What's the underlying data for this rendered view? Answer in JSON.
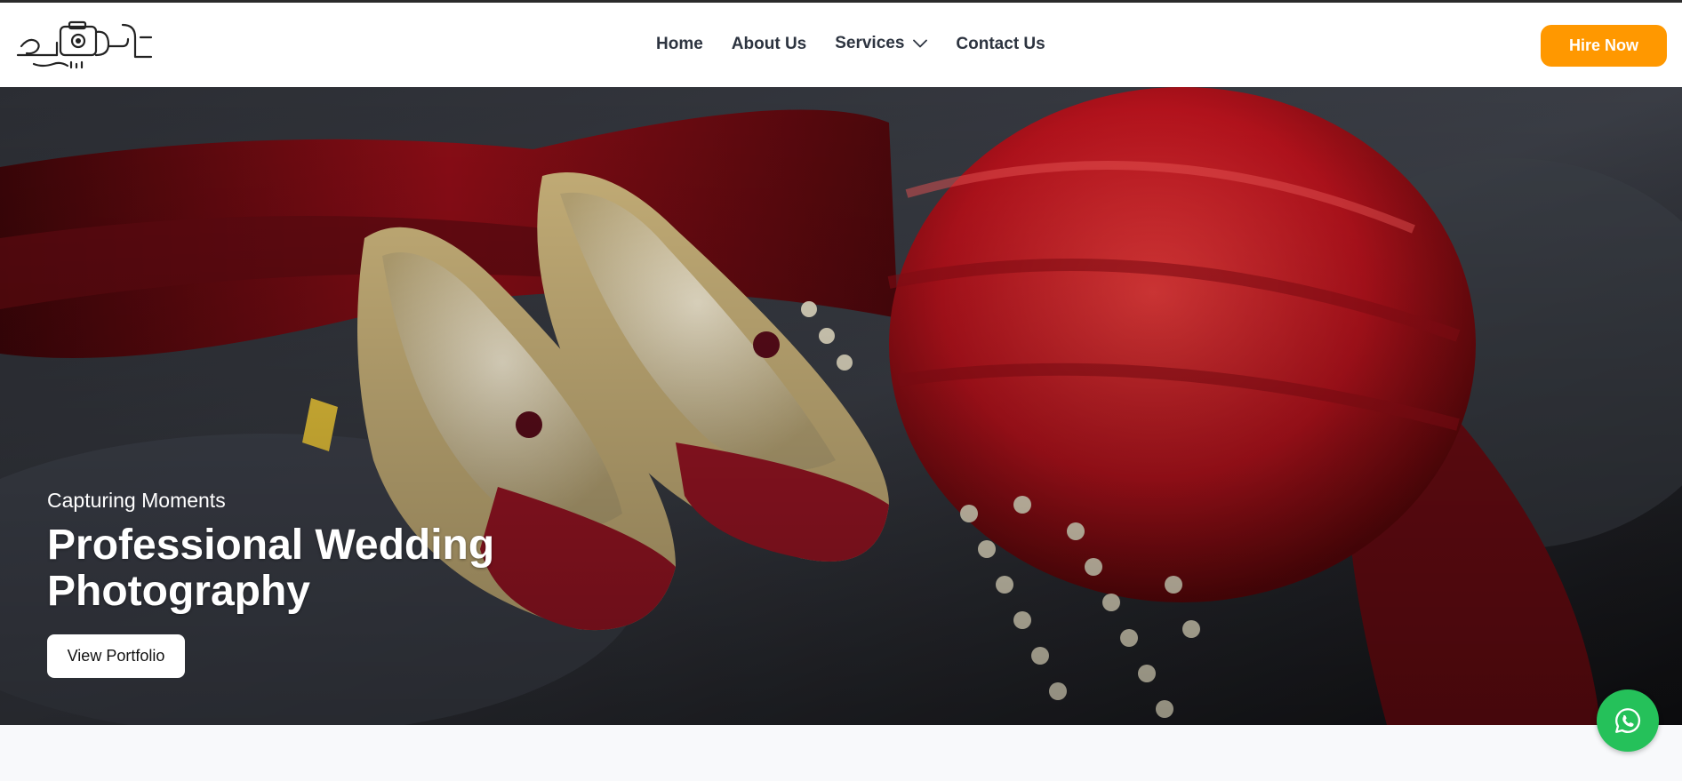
{
  "brand": {
    "logo_name": "Studio camera calligraphy logo"
  },
  "nav": {
    "items": [
      {
        "label": "Home"
      },
      {
        "label": "About Us"
      },
      {
        "label": "Services"
      },
      {
        "label": "Contact Us"
      }
    ],
    "cta_label": "Hire Now",
    "cta_color": "#ff9800"
  },
  "hero": {
    "subtitle": "Capturing Moments",
    "title": "Professional Wedding Photography",
    "button_label": "View Portfolio"
  },
  "floating": {
    "icon": "whatsapp-icon",
    "color": "#25c15a"
  }
}
